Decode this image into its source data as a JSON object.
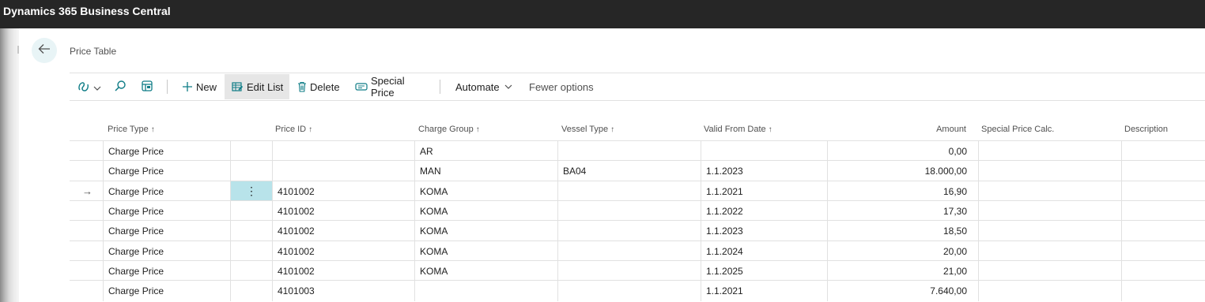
{
  "app": {
    "title": "Dynamics 365 Business Central"
  },
  "page": {
    "title": "Price Table"
  },
  "toolbar": {
    "new_label": "New",
    "edit_list_label": "Edit List",
    "delete_label": "Delete",
    "special_price_label": "Special Price",
    "automate_label": "Automate",
    "fewer_options_label": "Fewer options"
  },
  "table": {
    "headers": {
      "price_type": "Price Type",
      "price_id": "Price ID",
      "charge_group": "Charge Group",
      "vessel_type": "Vessel Type",
      "valid_from": "Valid From Date",
      "amount": "Amount",
      "special_calc": "Special Price Calc.",
      "description": "Description"
    },
    "sort_arrow": "↑",
    "current_row_marker": "→",
    "row_menu_glyph": "⋮",
    "rows": [
      {
        "price_type": "Charge Price",
        "price_id": "",
        "charge_group": "AR",
        "vessel_type": "",
        "valid_from": "",
        "amount": "0,00",
        "special_calc": "",
        "description": ""
      },
      {
        "price_type": "Charge Price",
        "price_id": "",
        "charge_group": "MAN",
        "vessel_type": "BA04",
        "valid_from": "1.1.2023",
        "amount": "18.000,00",
        "special_calc": "",
        "description": ""
      },
      {
        "price_type": "Charge Price",
        "price_id": "4101002",
        "charge_group": "KOMA",
        "vessel_type": "",
        "valid_from": "1.1.2021",
        "amount": "16,90",
        "special_calc": "",
        "description": ""
      },
      {
        "price_type": "Charge Price",
        "price_id": "4101002",
        "charge_group": "KOMA",
        "vessel_type": "",
        "valid_from": "1.1.2022",
        "amount": "17,30",
        "special_calc": "",
        "description": ""
      },
      {
        "price_type": "Charge Price",
        "price_id": "4101002",
        "charge_group": "KOMA",
        "vessel_type": "",
        "valid_from": "1.1.2023",
        "amount": "18,50",
        "special_calc": "",
        "description": ""
      },
      {
        "price_type": "Charge Price",
        "price_id": "4101002",
        "charge_group": "KOMA",
        "vessel_type": "",
        "valid_from": "1.1.2024",
        "amount": "20,00",
        "special_calc": "",
        "description": ""
      },
      {
        "price_type": "Charge Price",
        "price_id": "4101002",
        "charge_group": "KOMA",
        "vessel_type": "",
        "valid_from": "1.1.2025",
        "amount": "21,00",
        "special_calc": "",
        "description": ""
      },
      {
        "price_type": "Charge Price",
        "price_id": "4101003",
        "charge_group": "",
        "vessel_type": "",
        "valid_from": "1.1.2021",
        "amount": "7.640,00",
        "special_calc": "",
        "description": ""
      }
    ]
  },
  "colors": {
    "topbar": "#262626",
    "accent": "#0e7c86",
    "selected_cell": "#b8e3ea",
    "active_button": "#e6e6e6"
  }
}
